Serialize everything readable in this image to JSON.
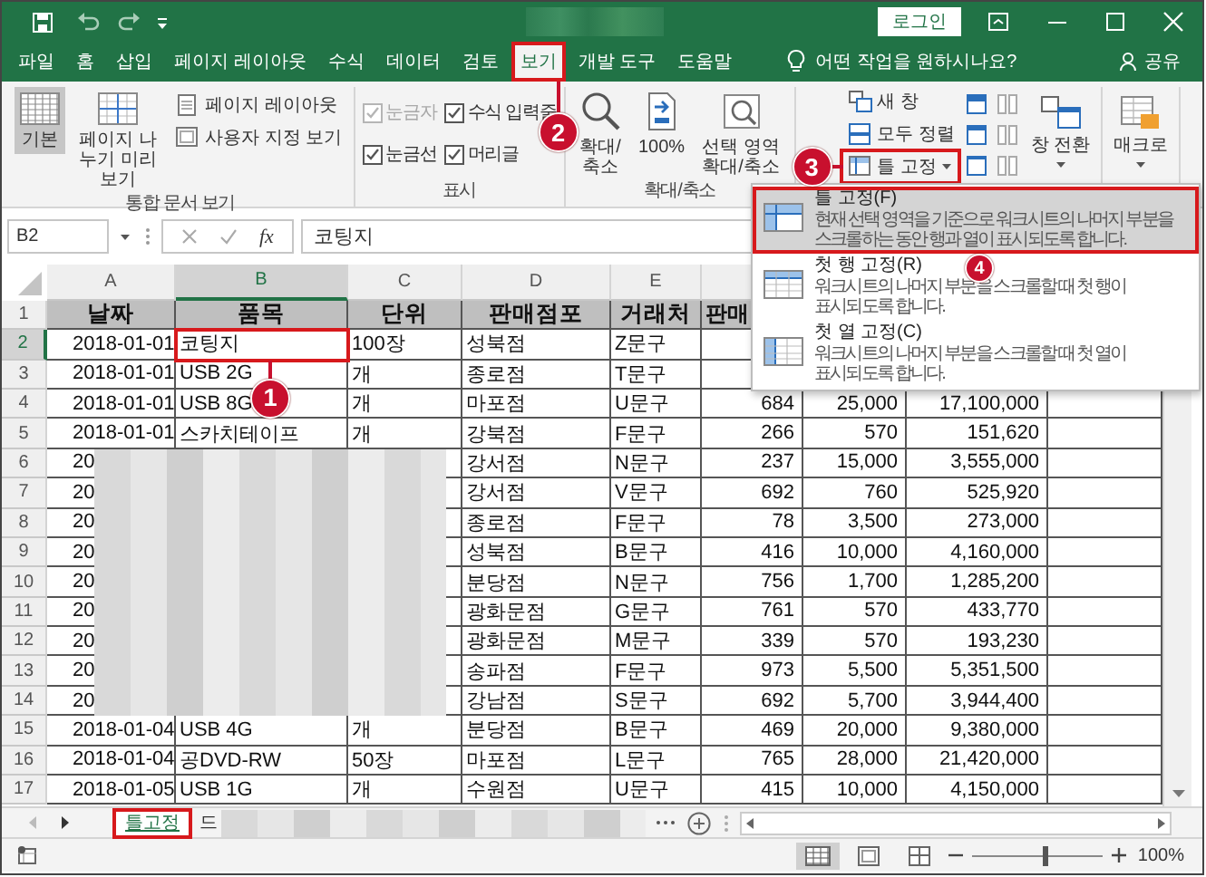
{
  "title_bar": {
    "login_button": "로그인"
  },
  "tabs": [
    {
      "label": "파일",
      "selected": false,
      "highlighted": false
    },
    {
      "label": "홈",
      "selected": false,
      "highlighted": false
    },
    {
      "label": "삽입",
      "selected": false,
      "highlighted": false
    },
    {
      "label": "페이지 레이아웃",
      "selected": false,
      "highlighted": false
    },
    {
      "label": "수식",
      "selected": false,
      "highlighted": false
    },
    {
      "label": "데이터",
      "selected": false,
      "highlighted": false
    },
    {
      "label": "검토",
      "selected": false,
      "highlighted": false
    },
    {
      "label": "보기",
      "selected": true,
      "highlighted": true
    },
    {
      "label": "개발 도구",
      "selected": false,
      "highlighted": false
    },
    {
      "label": "도움말",
      "selected": false,
      "highlighted": false
    }
  ],
  "tell_me": "어떤 작업을 원하시나요?",
  "share": "공유",
  "ribbon": {
    "groups": [
      {
        "kind": "views",
        "label": "통합 문서 보기",
        "large": [
          {
            "label": "기본",
            "selected": true
          },
          {
            "label": "페이지 나누기 미리 보기",
            "selected": false
          }
        ],
        "small": [
          "페이지 레이아웃",
          "사용자 지정 보기"
        ]
      },
      {
        "kind": "show",
        "label": "표시",
        "options": [
          {
            "label": "눈금자",
            "checked": true,
            "disabled": true
          },
          {
            "label": "수식 입력줄",
            "checked": true,
            "disabled": false
          },
          {
            "label": "눈금선",
            "checked": true,
            "disabled": false
          },
          {
            "label": "머리글",
            "checked": true,
            "disabled": false
          }
        ]
      },
      {
        "kind": "zoom",
        "label": "확대/축소",
        "large": [
          "확대/축소",
          "100%",
          "선택 영역 확대/축소"
        ]
      },
      {
        "kind": "window",
        "small": [
          {
            "label": "새 창",
            "highlighted": false
          },
          {
            "label": "모두 정렬",
            "highlighted": false
          },
          {
            "label": "틀 고정",
            "highlighted": true
          }
        ],
        "large": [
          "창 전환"
        ]
      },
      {
        "kind": "macros",
        "large": [
          "매크로"
        ]
      }
    ]
  },
  "formula_bar": {
    "name_box": "B2",
    "insert_function": "fx",
    "value": "코팅지"
  },
  "sheet": {
    "columns": [
      {
        "letter": "A",
        "selected": false
      },
      {
        "letter": "B",
        "selected": true
      },
      {
        "letter": "C",
        "selected": false
      },
      {
        "letter": "D",
        "selected": false
      },
      {
        "letter": "E",
        "selected": false
      }
    ],
    "rows": [
      {
        "number": "1",
        "kind": "header",
        "selected": false,
        "cells": [
          "날짜",
          "품목",
          "단위",
          "판매점포",
          "거래처",
          "판매",
          null,
          null
        ]
      },
      {
        "number": "2",
        "kind": "data",
        "selected": true,
        "cells": [
          "2018-01-01",
          {
            "text": "코팅지",
            "highlighted": true
          },
          "100장",
          "성북점",
          "Z문구",
          null,
          null,
          null
        ]
      },
      {
        "number": "3",
        "kind": "data",
        "selected": false,
        "cells": [
          "2018-01-01",
          "USB 2G",
          "개",
          "종로점",
          "T문구",
          null,
          null,
          null
        ]
      },
      {
        "number": "4",
        "kind": "data",
        "selected": false,
        "cells": [
          "2018-01-01",
          "USB 8G",
          "개",
          "마포점",
          "U문구",
          "684",
          "25,000",
          "17,100,000"
        ]
      },
      {
        "number": "5",
        "kind": "data",
        "selected": false,
        "cells": [
          "2018-01-01",
          "스카치테이프",
          "개",
          "강북점",
          "F문구",
          "266",
          "570",
          "151,620"
        ]
      },
      {
        "number": "6",
        "kind": "data",
        "selected": false,
        "cells": [
          "20",
          null,
          null,
          "강서점",
          "N문구",
          "237",
          "15,000",
          "3,555,000"
        ]
      },
      {
        "number": "7",
        "kind": "data",
        "selected": false,
        "cells": [
          "20",
          null,
          null,
          "강서점",
          "V문구",
          "692",
          "760",
          "525,920"
        ]
      },
      {
        "number": "8",
        "kind": "data",
        "selected": false,
        "cells": [
          "20",
          null,
          null,
          "종로점",
          "F문구",
          "78",
          "3,500",
          "273,000"
        ]
      },
      {
        "number": "9",
        "kind": "data",
        "selected": false,
        "cells": [
          "20",
          null,
          null,
          "성북점",
          "B문구",
          "416",
          "10,000",
          "4,160,000"
        ]
      },
      {
        "number": "10",
        "kind": "data",
        "selected": false,
        "cells": [
          "20",
          null,
          null,
          "분당점",
          "N문구",
          "756",
          "1,700",
          "1,285,200"
        ]
      },
      {
        "number": "11",
        "kind": "data",
        "selected": false,
        "cells": [
          "20",
          null,
          null,
          "광화문점",
          "G문구",
          "761",
          "570",
          "433,770"
        ]
      },
      {
        "number": "12",
        "kind": "data",
        "selected": false,
        "cells": [
          "20",
          null,
          null,
          "광화문점",
          "M문구",
          "339",
          "570",
          "193,230"
        ]
      },
      {
        "number": "13",
        "kind": "data",
        "selected": false,
        "cells": [
          "20",
          null,
          null,
          "송파점",
          "F문구",
          "973",
          "5,500",
          "5,351,500"
        ]
      },
      {
        "number": "14",
        "kind": "data",
        "selected": false,
        "cells": [
          "20",
          null,
          null,
          "강남점",
          "S문구",
          "692",
          "5,700",
          "3,944,400"
        ]
      },
      {
        "number": "15",
        "kind": "data",
        "selected": false,
        "cells": [
          "2018-01-04",
          "USB 4G",
          "개",
          "분당점",
          "B문구",
          "469",
          "20,000",
          "9,380,000"
        ]
      },
      {
        "number": "16",
        "kind": "data",
        "selected": false,
        "cells": [
          "2018-01-04",
          "공DVD-RW",
          "50장",
          "마포점",
          "L문구",
          "765",
          "28,000",
          "21,420,000"
        ]
      },
      {
        "number": "17",
        "kind": "data",
        "selected": false,
        "cells": [
          "2018-01-05",
          "USB 1G",
          "개",
          "수원점",
          "U문구",
          "415",
          "10,000",
          "4,150,000"
        ]
      }
    ]
  },
  "freeze_menu": [
    {
      "title": "틀 고정(F)",
      "description": "현재 선택 영역을 기준으로 워크시트의 나머지 부분을 스크롤하는 동안 행과 열이 표시되도록 합니다.",
      "selected": true
    },
    {
      "title": "첫 행 고정(R)",
      "description": "워크시트의 나머지 부분을 스크롤할 때 첫 행이 표시되도록 합니다.",
      "selected": false
    },
    {
      "title": "첫 열 고정(C)",
      "description": "워크시트의 나머지 부분을 스크롤할 때 첫 열이 표시되도록 합니다.",
      "selected": false
    }
  ],
  "sheet_tabs": [
    {
      "label": "틀고정",
      "selected": true,
      "highlighted": true
    },
    {
      "label": "드",
      "selected": false,
      "highlighted": false
    }
  ],
  "status_bar": {
    "views": [
      {
        "kind": "normal",
        "selected": true
      },
      {
        "kind": "page-layout",
        "selected": false
      },
      {
        "kind": "page-break",
        "selected": false
      }
    ],
    "zoom": {
      "level": 0.55,
      "reading": "100%"
    }
  },
  "callouts": [
    "1",
    "2",
    "3",
    "4"
  ]
}
